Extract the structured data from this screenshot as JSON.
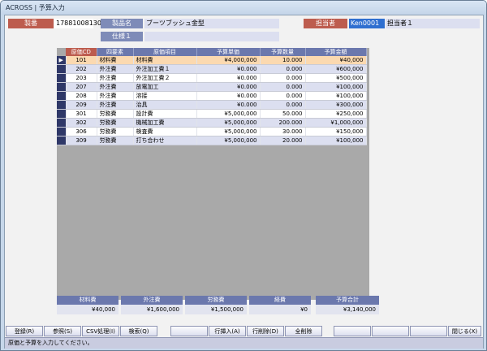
{
  "window": {
    "title": "ACROSS | 予算入力"
  },
  "header": {
    "seiban_label": "製番",
    "seiban_value": "17881008130",
    "product_label": "製品名",
    "product_value": "ブーツブッシュ金型",
    "spec_label": "仕様１",
    "spec_value": "",
    "person_label": "担当者",
    "person_code": "Ken0001",
    "person_name": "担当者１"
  },
  "grid": {
    "columns": [
      "原価CD",
      "四要素",
      "原価項目",
      "予算単価",
      "予算数量",
      "予算金額"
    ],
    "rows": [
      {
        "cd": "101",
        "element": "材料費",
        "item": "材料費",
        "price": "¥4,000,000",
        "qty": "10.000",
        "amount": "¥40,000"
      },
      {
        "cd": "202",
        "element": "外注費",
        "item": "外注加工費１",
        "price": "¥0.000",
        "qty": "0.000",
        "amount": "¥600,000"
      },
      {
        "cd": "203",
        "element": "外注費",
        "item": "外注加工費２",
        "price": "¥0.000",
        "qty": "0.000",
        "amount": "¥500,000"
      },
      {
        "cd": "207",
        "element": "外注費",
        "item": "放電加工",
        "price": "¥0.000",
        "qty": "0.000",
        "amount": "¥100,000"
      },
      {
        "cd": "208",
        "element": "外注費",
        "item": "溶接",
        "price": "¥0.000",
        "qty": "0.000",
        "amount": "¥100,000"
      },
      {
        "cd": "209",
        "element": "外注費",
        "item": "治具",
        "price": "¥0.000",
        "qty": "0.000",
        "amount": "¥300,000"
      },
      {
        "cd": "301",
        "element": "労務費",
        "item": "設計費",
        "price": "¥5,000,000",
        "qty": "50.000",
        "amount": "¥250,000"
      },
      {
        "cd": "302",
        "element": "労務費",
        "item": "機械加工費",
        "price": "¥5,000,000",
        "qty": "200.000",
        "amount": "¥1,000,000"
      },
      {
        "cd": "306",
        "element": "労務費",
        "item": "検査費",
        "price": "¥5,000,000",
        "qty": "30.000",
        "amount": "¥150,000"
      },
      {
        "cd": "309",
        "element": "労務費",
        "item": "打ち合わせ",
        "price": "¥5,000,000",
        "qty": "20.000",
        "amount": "¥100,000"
      }
    ]
  },
  "summary": [
    {
      "label": "材料費",
      "value": "¥40,000"
    },
    {
      "label": "外注費",
      "value": "¥1,600,000"
    },
    {
      "label": "労務費",
      "value": "¥1,500,000"
    },
    {
      "label": "経費",
      "value": "¥0"
    },
    {
      "label": "予算合計",
      "value": "¥3,140,000"
    }
  ],
  "buttons": {
    "register": "登録(R)",
    "reference": "参照(S)",
    "csv": "CSV処理(I)",
    "search": "検索(Q)",
    "insert_row": "行挿入(A)",
    "delete_row": "行削除(D)",
    "delete_all": "全削除",
    "close": "閉じる(X)"
  },
  "status": {
    "message": "原価と予算を入力してください。"
  },
  "icons": {
    "row_indicator": "row-pointer-icon"
  }
}
